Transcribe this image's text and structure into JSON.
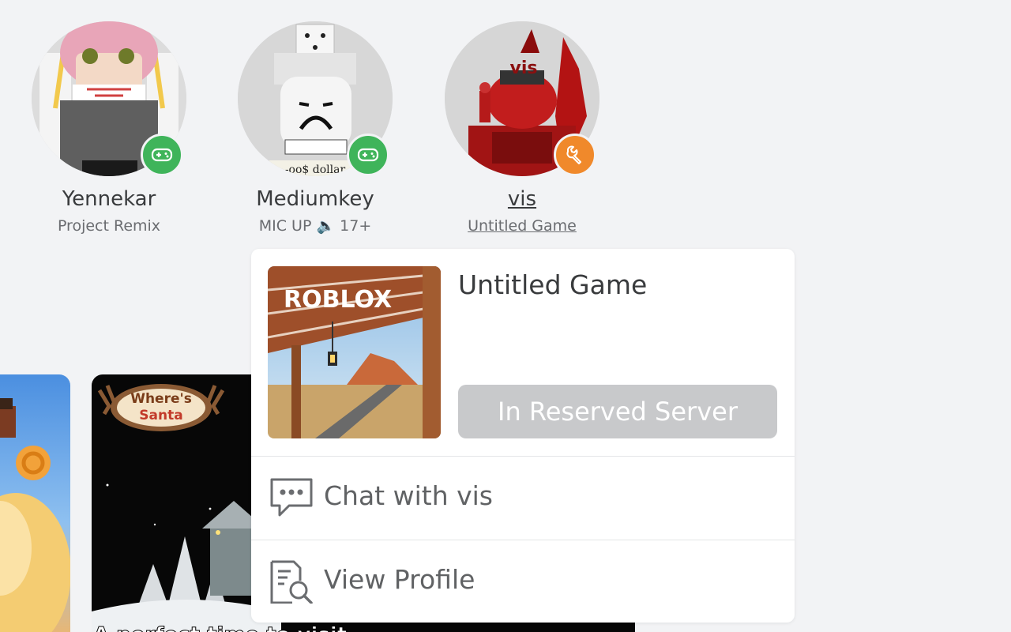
{
  "friends": [
    {
      "name": "Yennekar",
      "status": "Project Remix",
      "presence_icon": "controller-icon",
      "presence_color": "#3fb45a"
    },
    {
      "name": "Mediumkey",
      "status": "MIC UP 🔈 17+",
      "presence_icon": "controller-icon",
      "presence_color": "#3fb45a"
    },
    {
      "name": "vis",
      "status": "Untitled Game",
      "presence_icon": "wrench-icon",
      "presence_color": "#f0892b"
    }
  ],
  "background_tiles": [
    {
      "title": "Where's Santa",
      "caption": "A perfect time to visit"
    }
  ],
  "popup": {
    "thumbnail_logo": "ROBLOX",
    "game_title": "Untitled Game",
    "join_button": "In Reserved Server",
    "menu": [
      {
        "label": "Chat with vis",
        "icon": "chat-icon"
      },
      {
        "label": "View Profile",
        "icon": "view-profile-icon"
      }
    ]
  },
  "colors": {
    "background": "#f2f3f5",
    "card": "#ffffff",
    "disabled_button": "#c8c9cb",
    "online_in_game": "#3fb45a",
    "in_studio": "#f0892b"
  }
}
